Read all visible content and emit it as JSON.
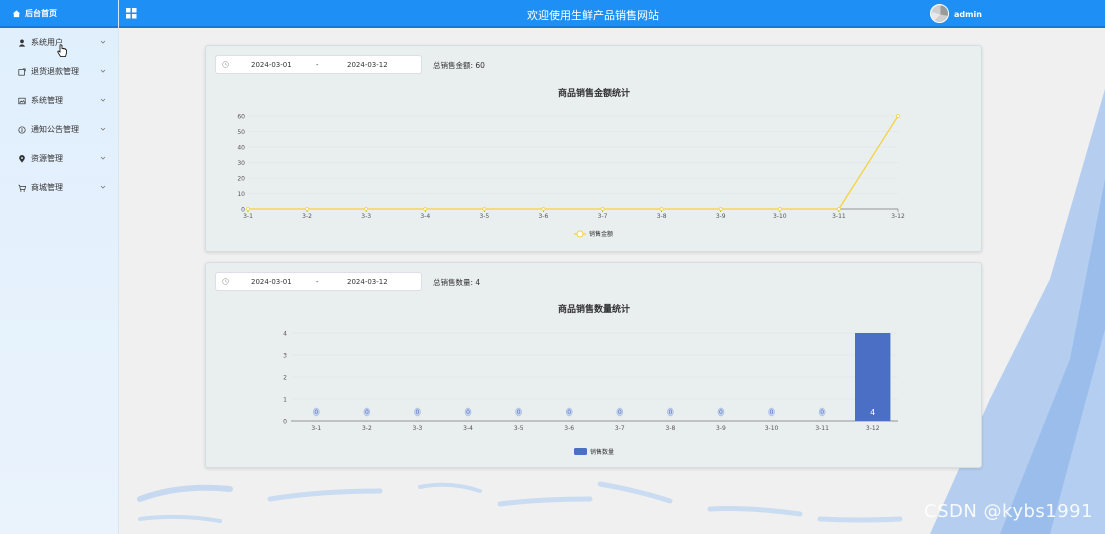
{
  "sidebar": {
    "home_label": "后台首页",
    "items": [
      {
        "label": "系统用户",
        "icon": "user-icon"
      },
      {
        "label": "退货退款管理",
        "icon": "return-icon"
      },
      {
        "label": "系统管理",
        "icon": "image-icon"
      },
      {
        "label": "通知公告管理",
        "icon": "info-icon"
      },
      {
        "label": "资源管理",
        "icon": "location-icon"
      },
      {
        "label": "商城管理",
        "icon": "cart-icon"
      }
    ]
  },
  "header": {
    "title": "欢迎使用生鲜产品销售网站",
    "username": "admin"
  },
  "colors": {
    "primary": "#1e90f5",
    "line": "#f5d33c",
    "bar": "#4a6fc4"
  },
  "cards": [
    {
      "start_date": "2024-03-01",
      "separator": "-",
      "end_date": "2024-03-12",
      "total_label": "总销售金额: 60"
    },
    {
      "start_date": "2024-03-01",
      "separator": "-",
      "end_date": "2024-03-12",
      "total_label": "总销售数量: 4"
    }
  ],
  "chart_data": [
    {
      "type": "line",
      "title": "商品销售金额统计",
      "categories": [
        "3-1",
        "3-2",
        "3-3",
        "3-4",
        "3-5",
        "3-6",
        "3-7",
        "3-8",
        "3-9",
        "3-10",
        "3-11",
        "3-12"
      ],
      "series": [
        {
          "name": "销售金额",
          "values": [
            0,
            0,
            0,
            0,
            0,
            0,
            0,
            0,
            0,
            0,
            0,
            60
          ]
        }
      ],
      "ylim": [
        0,
        60
      ],
      "yticks": [
        0,
        10,
        20,
        30,
        40,
        50,
        60
      ],
      "legend": "bottom",
      "grid": true
    },
    {
      "type": "bar",
      "title": "商品销售数量统计",
      "categories": [
        "3-1",
        "3-2",
        "3-3",
        "3-4",
        "3-5",
        "3-6",
        "3-7",
        "3-8",
        "3-9",
        "3-10",
        "3-11",
        "3-12"
      ],
      "series": [
        {
          "name": "销售数量",
          "values": [
            0,
            0,
            0,
            0,
            0,
            0,
            0,
            0,
            0,
            0,
            0,
            4
          ]
        }
      ],
      "ylim": [
        0,
        4
      ],
      "yticks": [
        0,
        1,
        2,
        3,
        4
      ],
      "legend": "bottom",
      "grid": true,
      "data_labels": [
        "0",
        "0",
        "0",
        "0",
        "0",
        "0",
        "0",
        "0",
        "0",
        "0",
        "0",
        "4"
      ]
    }
  ],
  "watermark": "CSDN @kybs1991"
}
